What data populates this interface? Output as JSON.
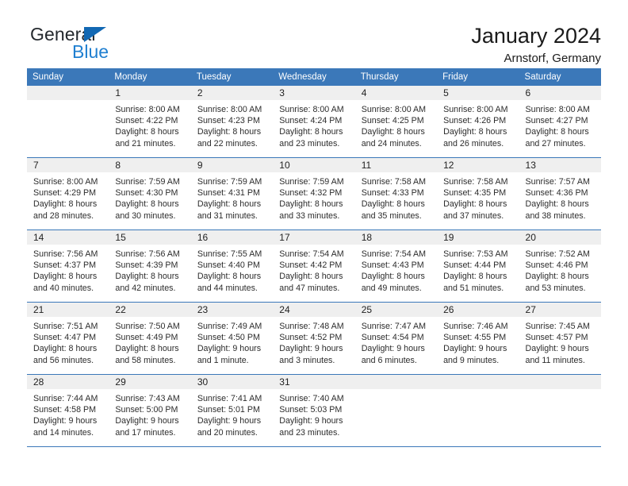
{
  "brand": {
    "name_part1": "General",
    "name_part2": "Blue",
    "triangle_color": "#1268b3",
    "blue_text_color": "#1f7fd0"
  },
  "header": {
    "title": "January 2024",
    "subtitle": "Arnstorf, Germany"
  },
  "theme": {
    "header_bg": "#3b78b9",
    "daynum_bg": "#efefef",
    "rule_color": "#3b78b9"
  },
  "weekdays": [
    "Sunday",
    "Monday",
    "Tuesday",
    "Wednesday",
    "Thursday",
    "Friday",
    "Saturday"
  ],
  "labels": {
    "sunrise_prefix": "Sunrise:",
    "sunset_prefix": "Sunset:",
    "daylight_prefix": "Daylight:"
  },
  "weeks": [
    [
      {
        "day": "",
        "empty": true
      },
      {
        "day": "1",
        "sunrise": "Sunrise: 8:00 AM",
        "sunset": "Sunset: 4:22 PM",
        "daylight_l1": "Daylight: 8 hours",
        "daylight_l2": "and 21 minutes."
      },
      {
        "day": "2",
        "sunrise": "Sunrise: 8:00 AM",
        "sunset": "Sunset: 4:23 PM",
        "daylight_l1": "Daylight: 8 hours",
        "daylight_l2": "and 22 minutes."
      },
      {
        "day": "3",
        "sunrise": "Sunrise: 8:00 AM",
        "sunset": "Sunset: 4:24 PM",
        "daylight_l1": "Daylight: 8 hours",
        "daylight_l2": "and 23 minutes."
      },
      {
        "day": "4",
        "sunrise": "Sunrise: 8:00 AM",
        "sunset": "Sunset: 4:25 PM",
        "daylight_l1": "Daylight: 8 hours",
        "daylight_l2": "and 24 minutes."
      },
      {
        "day": "5",
        "sunrise": "Sunrise: 8:00 AM",
        "sunset": "Sunset: 4:26 PM",
        "daylight_l1": "Daylight: 8 hours",
        "daylight_l2": "and 26 minutes."
      },
      {
        "day": "6",
        "sunrise": "Sunrise: 8:00 AM",
        "sunset": "Sunset: 4:27 PM",
        "daylight_l1": "Daylight: 8 hours",
        "daylight_l2": "and 27 minutes."
      }
    ],
    [
      {
        "day": "7",
        "sunrise": "Sunrise: 8:00 AM",
        "sunset": "Sunset: 4:29 PM",
        "daylight_l1": "Daylight: 8 hours",
        "daylight_l2": "and 28 minutes."
      },
      {
        "day": "8",
        "sunrise": "Sunrise: 7:59 AM",
        "sunset": "Sunset: 4:30 PM",
        "daylight_l1": "Daylight: 8 hours",
        "daylight_l2": "and 30 minutes."
      },
      {
        "day": "9",
        "sunrise": "Sunrise: 7:59 AM",
        "sunset": "Sunset: 4:31 PM",
        "daylight_l1": "Daylight: 8 hours",
        "daylight_l2": "and 31 minutes."
      },
      {
        "day": "10",
        "sunrise": "Sunrise: 7:59 AM",
        "sunset": "Sunset: 4:32 PM",
        "daylight_l1": "Daylight: 8 hours",
        "daylight_l2": "and 33 minutes."
      },
      {
        "day": "11",
        "sunrise": "Sunrise: 7:58 AM",
        "sunset": "Sunset: 4:33 PM",
        "daylight_l1": "Daylight: 8 hours",
        "daylight_l2": "and 35 minutes."
      },
      {
        "day": "12",
        "sunrise": "Sunrise: 7:58 AM",
        "sunset": "Sunset: 4:35 PM",
        "daylight_l1": "Daylight: 8 hours",
        "daylight_l2": "and 37 minutes."
      },
      {
        "day": "13",
        "sunrise": "Sunrise: 7:57 AM",
        "sunset": "Sunset: 4:36 PM",
        "daylight_l1": "Daylight: 8 hours",
        "daylight_l2": "and 38 minutes."
      }
    ],
    [
      {
        "day": "14",
        "sunrise": "Sunrise: 7:56 AM",
        "sunset": "Sunset: 4:37 PM",
        "daylight_l1": "Daylight: 8 hours",
        "daylight_l2": "and 40 minutes."
      },
      {
        "day": "15",
        "sunrise": "Sunrise: 7:56 AM",
        "sunset": "Sunset: 4:39 PM",
        "daylight_l1": "Daylight: 8 hours",
        "daylight_l2": "and 42 minutes."
      },
      {
        "day": "16",
        "sunrise": "Sunrise: 7:55 AM",
        "sunset": "Sunset: 4:40 PM",
        "daylight_l1": "Daylight: 8 hours",
        "daylight_l2": "and 44 minutes."
      },
      {
        "day": "17",
        "sunrise": "Sunrise: 7:54 AM",
        "sunset": "Sunset: 4:42 PM",
        "daylight_l1": "Daylight: 8 hours",
        "daylight_l2": "and 47 minutes."
      },
      {
        "day": "18",
        "sunrise": "Sunrise: 7:54 AM",
        "sunset": "Sunset: 4:43 PM",
        "daylight_l1": "Daylight: 8 hours",
        "daylight_l2": "and 49 minutes."
      },
      {
        "day": "19",
        "sunrise": "Sunrise: 7:53 AM",
        "sunset": "Sunset: 4:44 PM",
        "daylight_l1": "Daylight: 8 hours",
        "daylight_l2": "and 51 minutes."
      },
      {
        "day": "20",
        "sunrise": "Sunrise: 7:52 AM",
        "sunset": "Sunset: 4:46 PM",
        "daylight_l1": "Daylight: 8 hours",
        "daylight_l2": "and 53 minutes."
      }
    ],
    [
      {
        "day": "21",
        "sunrise": "Sunrise: 7:51 AM",
        "sunset": "Sunset: 4:47 PM",
        "daylight_l1": "Daylight: 8 hours",
        "daylight_l2": "and 56 minutes."
      },
      {
        "day": "22",
        "sunrise": "Sunrise: 7:50 AM",
        "sunset": "Sunset: 4:49 PM",
        "daylight_l1": "Daylight: 8 hours",
        "daylight_l2": "and 58 minutes."
      },
      {
        "day": "23",
        "sunrise": "Sunrise: 7:49 AM",
        "sunset": "Sunset: 4:50 PM",
        "daylight_l1": "Daylight: 9 hours",
        "daylight_l2": "and 1 minute."
      },
      {
        "day": "24",
        "sunrise": "Sunrise: 7:48 AM",
        "sunset": "Sunset: 4:52 PM",
        "daylight_l1": "Daylight: 9 hours",
        "daylight_l2": "and 3 minutes."
      },
      {
        "day": "25",
        "sunrise": "Sunrise: 7:47 AM",
        "sunset": "Sunset: 4:54 PM",
        "daylight_l1": "Daylight: 9 hours",
        "daylight_l2": "and 6 minutes."
      },
      {
        "day": "26",
        "sunrise": "Sunrise: 7:46 AM",
        "sunset": "Sunset: 4:55 PM",
        "daylight_l1": "Daylight: 9 hours",
        "daylight_l2": "and 9 minutes."
      },
      {
        "day": "27",
        "sunrise": "Sunrise: 7:45 AM",
        "sunset": "Sunset: 4:57 PM",
        "daylight_l1": "Daylight: 9 hours",
        "daylight_l2": "and 11 minutes."
      }
    ],
    [
      {
        "day": "28",
        "sunrise": "Sunrise: 7:44 AM",
        "sunset": "Sunset: 4:58 PM",
        "daylight_l1": "Daylight: 9 hours",
        "daylight_l2": "and 14 minutes."
      },
      {
        "day": "29",
        "sunrise": "Sunrise: 7:43 AM",
        "sunset": "Sunset: 5:00 PM",
        "daylight_l1": "Daylight: 9 hours",
        "daylight_l2": "and 17 minutes."
      },
      {
        "day": "30",
        "sunrise": "Sunrise: 7:41 AM",
        "sunset": "Sunset: 5:01 PM",
        "daylight_l1": "Daylight: 9 hours",
        "daylight_l2": "and 20 minutes."
      },
      {
        "day": "31",
        "sunrise": "Sunrise: 7:40 AM",
        "sunset": "Sunset: 5:03 PM",
        "daylight_l1": "Daylight: 9 hours",
        "daylight_l2": "and 23 minutes."
      },
      {
        "day": "",
        "empty": true
      },
      {
        "day": "",
        "empty": true
      },
      {
        "day": "",
        "empty": true
      }
    ]
  ]
}
